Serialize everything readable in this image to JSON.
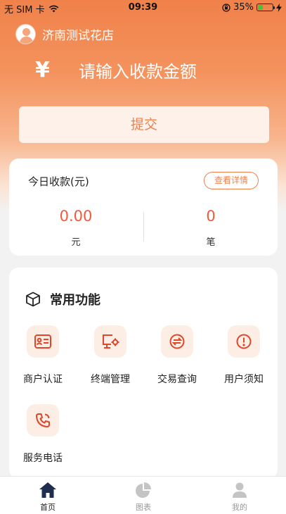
{
  "status_bar": {
    "carrier": "无 SIM 卡",
    "time": "09:39",
    "battery": "35%",
    "battery_level": 0.35
  },
  "header": {
    "store_name": "济南测试花店"
  },
  "payment": {
    "currency_symbol": "¥",
    "amount_placeholder": "请输入收款金额",
    "submit_label": "提交"
  },
  "stats": {
    "title": "今日收款(元)",
    "detail_label": "查看详情",
    "amount": {
      "value": "0.00",
      "unit": "元"
    },
    "count": {
      "value": "0",
      "unit": "笔"
    }
  },
  "functions": {
    "title": "常用功能",
    "items": [
      {
        "label": "商户认证",
        "icon": "id-card-icon"
      },
      {
        "label": "终端管理",
        "icon": "monitor-settings-icon"
      },
      {
        "label": "交易查询",
        "icon": "exchange-icon"
      },
      {
        "label": "用户须知",
        "icon": "alert-circle-icon"
      },
      {
        "label": "服务电话",
        "icon": "phone-icon"
      }
    ]
  },
  "tabbar": {
    "tabs": [
      {
        "label": "首页",
        "icon": "home-icon",
        "active": true
      },
      {
        "label": "图表",
        "icon": "pie-chart-icon",
        "active": false
      },
      {
        "label": "我的",
        "icon": "user-icon",
        "active": false
      }
    ]
  },
  "colors": {
    "accent": "#f0814a",
    "value_red": "#f05a3a",
    "active_tab": "#1f2d4e",
    "inactive_tab": "#c4c4c4"
  }
}
